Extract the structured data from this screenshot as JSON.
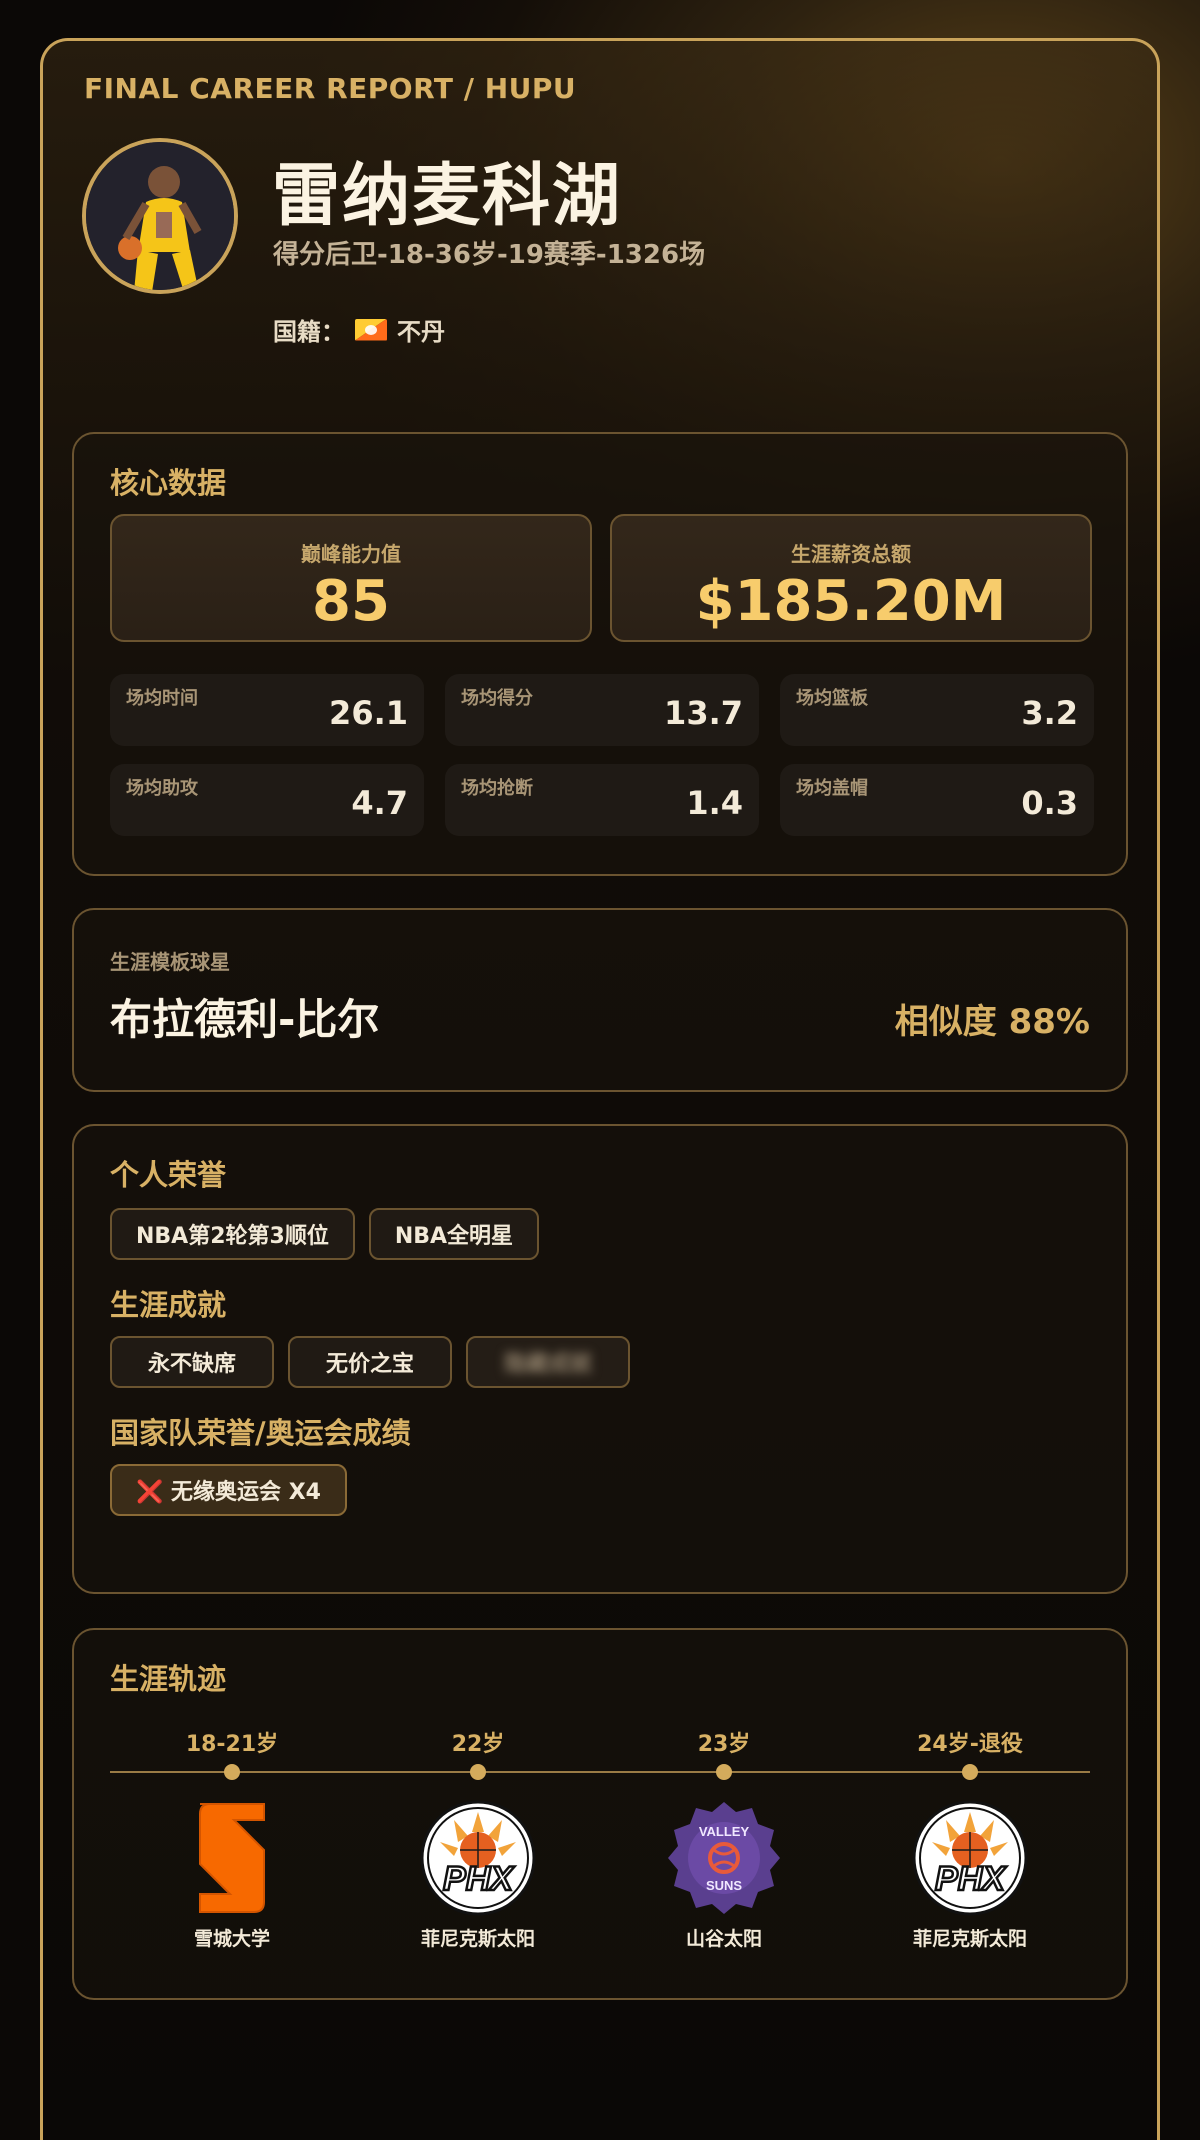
{
  "header": {
    "report_label": "FINAL CAREER REPORT / HUPU",
    "player_name": "雷纳麦科湖",
    "player_meta": "得分后卫-18-36岁-19赛季-1326场",
    "nationality_label": "国籍：",
    "nationality_value": "不丹",
    "flag_icon": "bhutan-flag-icon"
  },
  "core_stats": {
    "title": "核心数据",
    "peak": {
      "label": "巅峰能力值",
      "value": "85"
    },
    "salary": {
      "label": "生涯薪资总额",
      "value": "$185.20M"
    },
    "items": [
      {
        "label": "场均时间",
        "value": "26.1"
      },
      {
        "label": "场均得分",
        "value": "13.7"
      },
      {
        "label": "场均篮板",
        "value": "3.2"
      },
      {
        "label": "场均助攻",
        "value": "4.7"
      },
      {
        "label": "场均抢断",
        "value": "1.4"
      },
      {
        "label": "场均盖帽",
        "value": "0.3"
      }
    ]
  },
  "template": {
    "label": "生涯模板球星",
    "name": "布拉德利-比尔",
    "similarity": "相似度 88%"
  },
  "honors": {
    "personal_title": "个人荣誉",
    "personal": [
      "NBA第2轮第3顺位",
      "NBA全明星"
    ],
    "achievements_title": "生涯成就",
    "achievements": [
      "永不缺席",
      "无价之宝",
      "隐藏成就"
    ],
    "national_title": "国家队荣誉/奥运会成绩",
    "national": [
      "❌ 无缘奥运会 X4"
    ]
  },
  "timeline": {
    "title": "生涯轨迹",
    "stops": [
      {
        "age": "18-21岁",
        "team": "雪城大学",
        "logo": "syracuse-s-logo-icon"
      },
      {
        "age": "22岁",
        "team": "菲尼克斯太阳",
        "logo": "phx-suns-logo-icon"
      },
      {
        "age": "23岁",
        "team": "山谷太阳",
        "logo": "valley-suns-logo-icon"
      },
      {
        "age": "24岁-退役",
        "team": "菲尼克斯太阳",
        "logo": "phx-suns-logo-icon"
      }
    ]
  },
  "colors": {
    "accent_gold": "#d8b165",
    "value_gold": "#f7cc6c",
    "border": "#6b5430",
    "syracuse_orange": "#f76900",
    "valley_purple": "#5a3f8f"
  }
}
